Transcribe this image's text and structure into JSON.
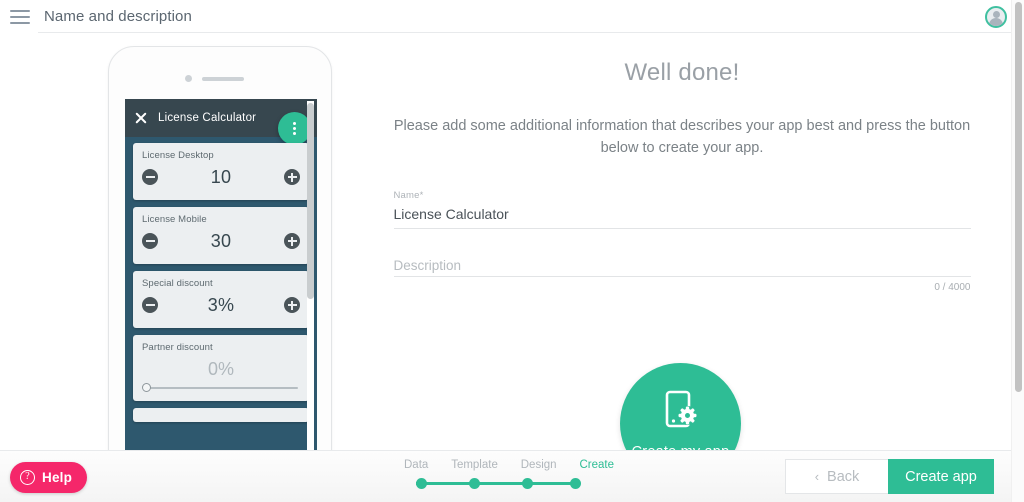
{
  "topbar": {
    "menu_icon": "hamburger-icon",
    "title": "Name and description",
    "avatar_icon": "user-avatar-icon"
  },
  "phone_preview": {
    "app_bar": {
      "close_icon": "close-x-icon",
      "title": "License Calculator",
      "fab_icon": "more-vertical-icon"
    },
    "cards": [
      {
        "label": "License Desktop",
        "type": "stepper",
        "value": "10",
        "minus_icon": "minus-circle-icon",
        "plus_icon": "plus-circle-icon"
      },
      {
        "label": "License Mobile",
        "type": "stepper",
        "value": "30",
        "minus_icon": "minus-circle-icon",
        "plus_icon": "plus-circle-icon"
      },
      {
        "label": "Special discount",
        "type": "stepper",
        "value": "3%",
        "minus_icon": "minus-circle-icon",
        "plus_icon": "plus-circle-icon"
      },
      {
        "label": "Partner discount",
        "type": "slider",
        "value": "0%"
      }
    ]
  },
  "content": {
    "headline": "Well done!",
    "subtext": "Please add some additional information that describes your app best and press the button below to create your app.",
    "name_field": {
      "label": "Name",
      "required_mark": "*",
      "value": "License Calculator",
      "placeholder": ""
    },
    "description_field": {
      "label": "Description",
      "value": "",
      "placeholder": "",
      "char_count": "0 / 4000"
    },
    "create_circle": {
      "icon": "phone-gear-icon",
      "label": "Create my app"
    }
  },
  "footer": {
    "help": {
      "icon": "question-circle-icon",
      "label": "Help"
    },
    "steps": [
      {
        "label": "Data",
        "active": false
      },
      {
        "label": "Template",
        "active": false
      },
      {
        "label": "Design",
        "active": false
      },
      {
        "label": "Create",
        "active": true
      }
    ],
    "back_button": {
      "chevron": "‹",
      "label": "Back"
    },
    "create_button": {
      "label": "Create app"
    }
  },
  "colors": {
    "accent_green": "#2ebd95",
    "help_pink": "#f5276a",
    "app_bar_dark": "#37474f",
    "phone_bg": "#2e586e",
    "card_bg": "#eceff1"
  }
}
